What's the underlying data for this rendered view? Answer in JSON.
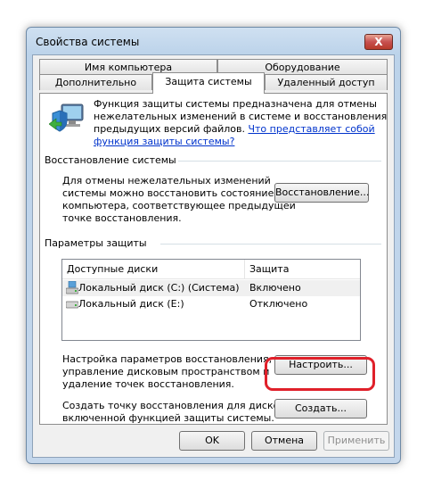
{
  "window": {
    "title": "Свойства системы",
    "close_label": "X"
  },
  "tabs": {
    "top_row": [
      "Имя компьютера",
      "Оборудование"
    ],
    "bottom_row": [
      "Дополнительно",
      "Защита системы",
      "Удаленный доступ"
    ],
    "active": "Защита системы"
  },
  "intro": {
    "line1": "Функция защиты системы предназначена для отмены",
    "line2": "нежелательных изменений в системе и восстановления",
    "line3_text": "предыдущих версий файлов. ",
    "link_part1": "Что представляет собой",
    "link_part2": "функция защиты системы?"
  },
  "restore": {
    "header": "Восстановление системы",
    "line1": "Для отмены нежелательных изменений",
    "line2": "системы можно восстановить состояние",
    "line3": "компьютера, соответствующее предыдущей",
    "line4": "точке восстановления.",
    "button": "Восстановление..."
  },
  "protection": {
    "header": "Параметры защиты",
    "columns": [
      "Доступные диски",
      "Защита"
    ],
    "rows": [
      {
        "disk": "Локальный диск (C:) (Система)",
        "status": "Включено"
      },
      {
        "disk": "Локальный диск (E:)",
        "status": "Отключено"
      }
    ],
    "configure_line1": "Настройка параметров восстановления,",
    "configure_line2": "управление дисковым пространством и",
    "configure_line3": "удаление точек восстановления.",
    "configure_button": "Настроить...",
    "create_line1": "Создать точку восстановления для дисков с",
    "create_line2": "включенной функцией защиты системы.",
    "create_button": "Создать..."
  },
  "footer": {
    "ok": "OK",
    "cancel": "Отмена",
    "apply": "Применить"
  },
  "colors": {
    "link": "#0033cc",
    "highlight": "#e0202a",
    "disabled_text": "#8f8f8f"
  }
}
